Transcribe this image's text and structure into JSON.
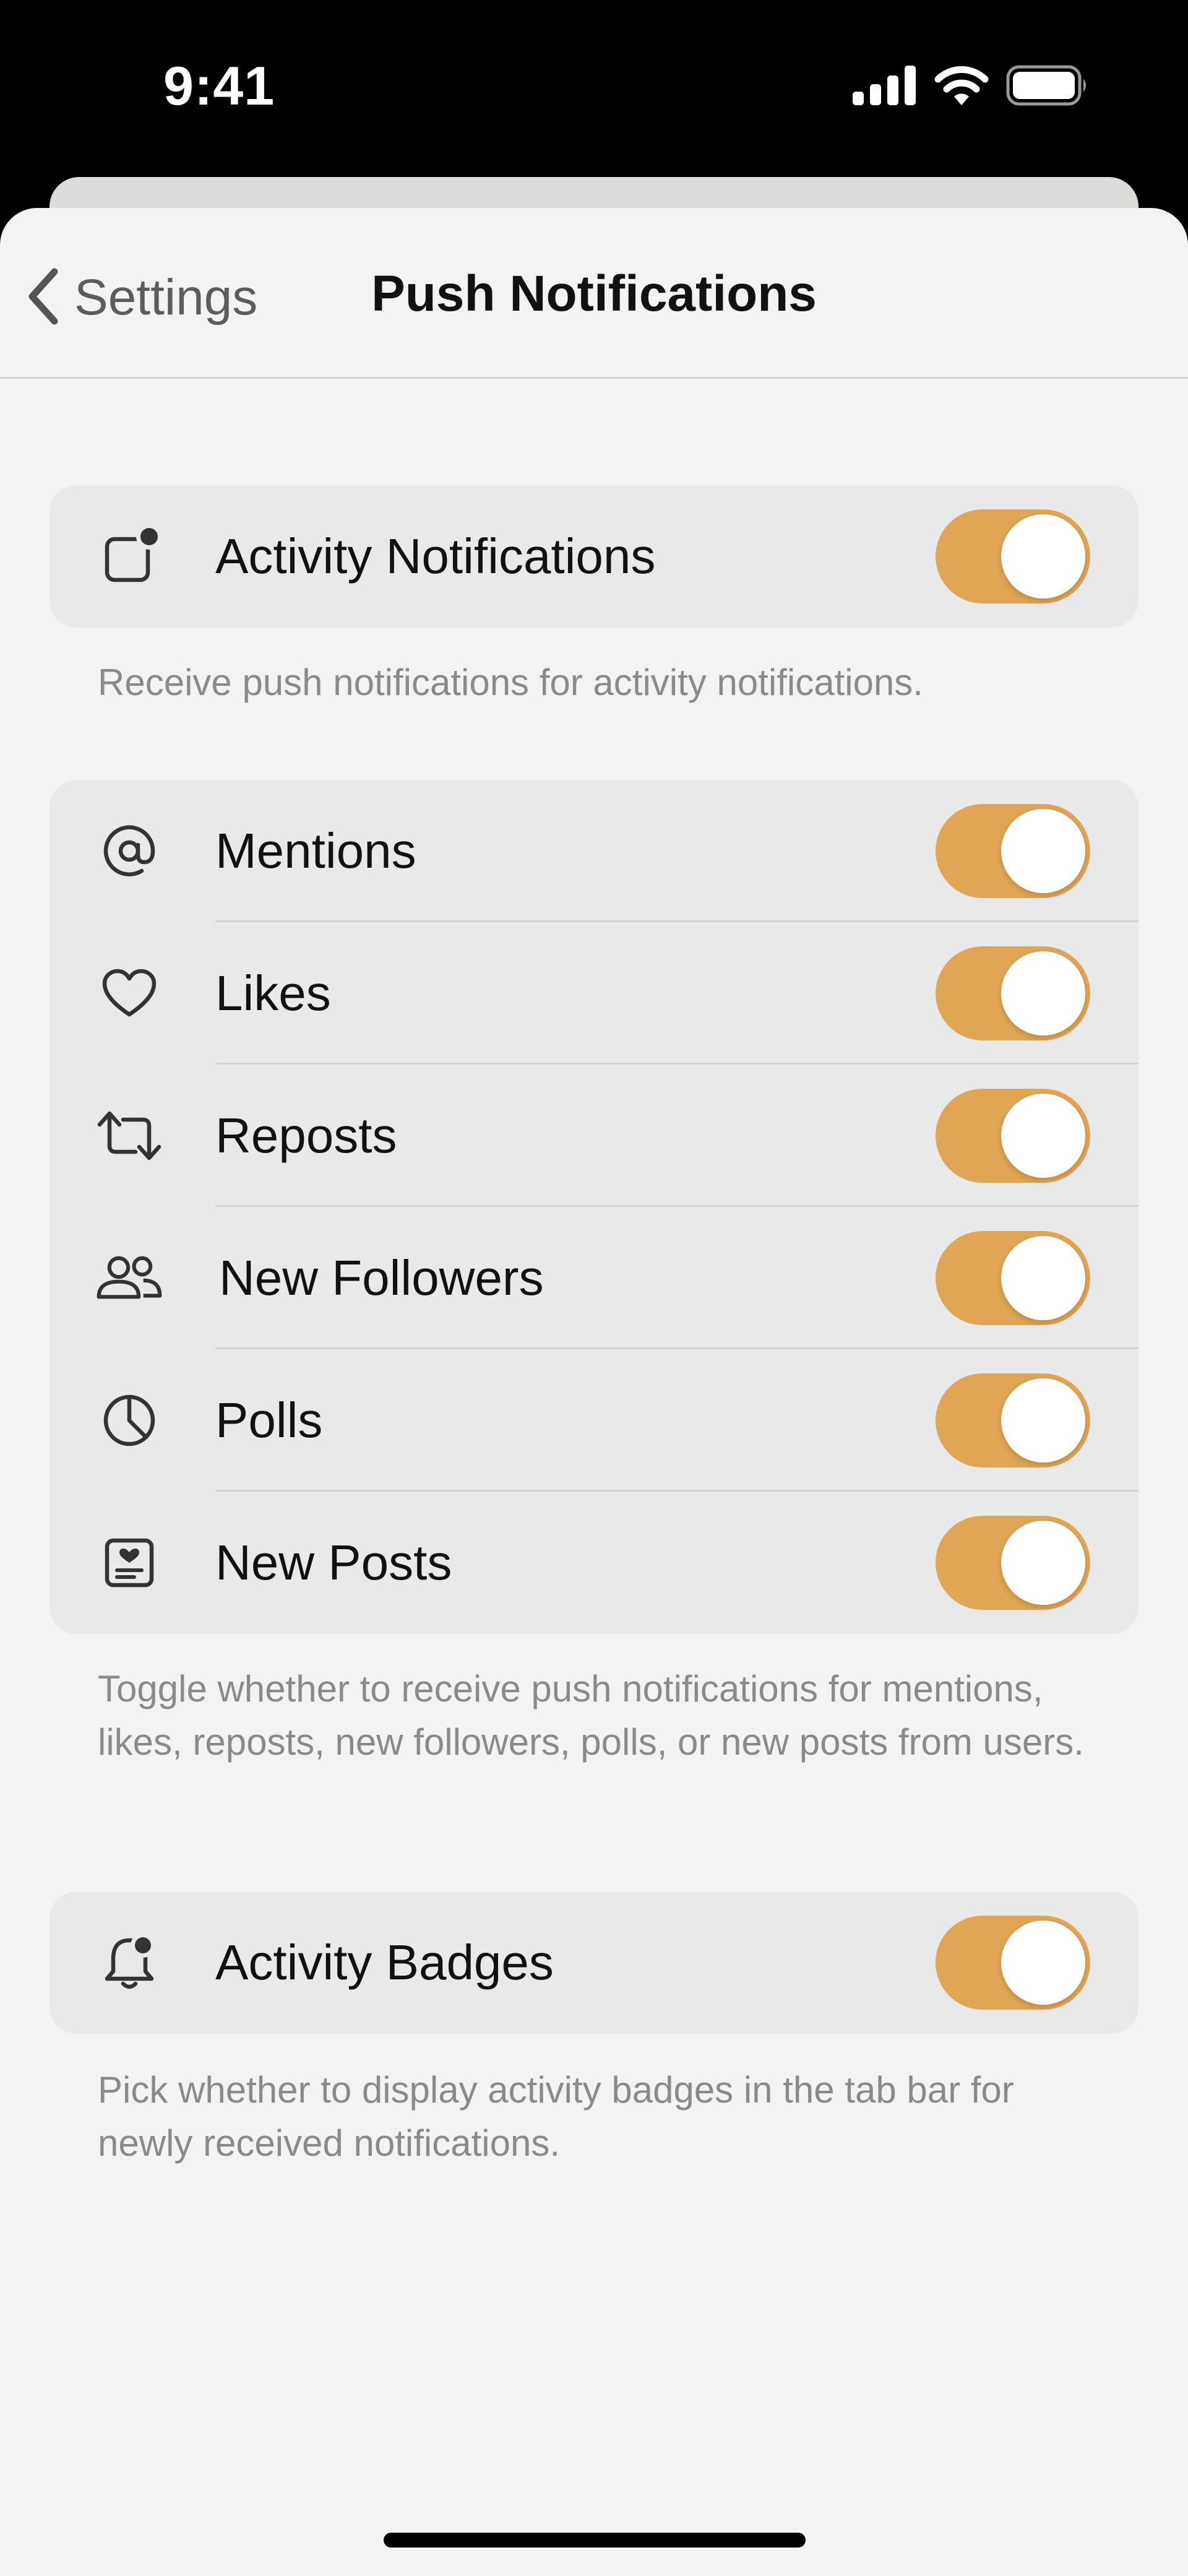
{
  "status_bar": {
    "time": "9:41",
    "icons": [
      "signal-icon",
      "wifi-icon",
      "battery-icon"
    ]
  },
  "nav": {
    "back_label": "Settings",
    "title": "Push Notifications"
  },
  "colors": {
    "accent": "#e0a655",
    "background": "#f3f3f3",
    "group_background": "#e9e9e9",
    "footer_text": "#8a8a8a"
  },
  "sections": [
    {
      "rows": [
        {
          "label": "Activity Notifications",
          "icon": "notification-dot-icon",
          "on": true
        }
      ],
      "footer": "Receive push notifications for activity notifications."
    },
    {
      "rows": [
        {
          "label": "Mentions",
          "icon": "at-sign-icon",
          "on": true
        },
        {
          "label": "Likes",
          "icon": "heart-icon",
          "on": true
        },
        {
          "label": "Reposts",
          "icon": "repost-icon",
          "on": true
        },
        {
          "label": "New Followers",
          "icon": "people-icon",
          "on": true
        },
        {
          "label": "Polls",
          "icon": "pie-chart-icon",
          "on": true
        },
        {
          "label": "New Posts",
          "icon": "post-icon",
          "on": true
        }
      ],
      "footer": "Toggle whether to receive push notifications for mentions, likes, reposts, new followers, polls, or new posts from users."
    },
    {
      "rows": [
        {
          "label": "Activity Badges",
          "icon": "bell-badge-icon",
          "on": true
        }
      ],
      "footer": "Pick whether to display activity badges in the tab bar for newly received notifications."
    }
  ]
}
